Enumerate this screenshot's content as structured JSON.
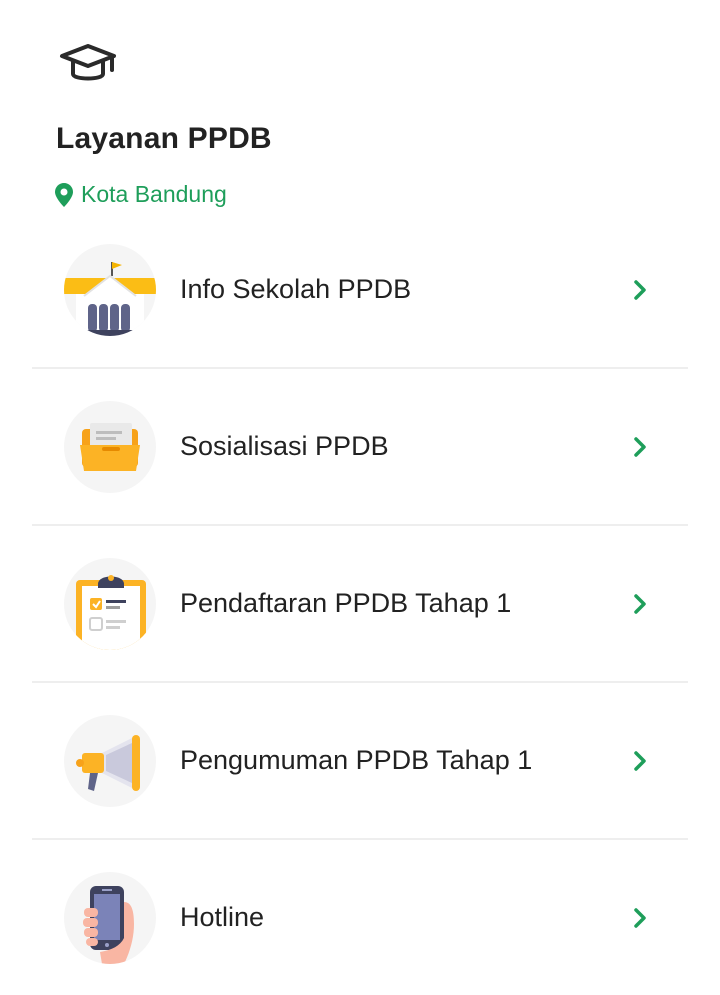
{
  "header": {
    "icon": "graduation-cap-icon",
    "title": "Layanan PPDB",
    "location_icon": "location-pin-icon",
    "location": "Kota Bandung"
  },
  "colors": {
    "accent": "#1e9e5a",
    "title": "#222222",
    "divider": "#eeeeee",
    "icon_bg": "#f5f5f5"
  },
  "menu": {
    "items": [
      {
        "label": "Info Sekolah PPDB",
        "icon": "school-building-icon"
      },
      {
        "label": "Sosialisasi PPDB",
        "icon": "folder-icon"
      },
      {
        "label": "Pendaftaran PPDB Tahap 1",
        "icon": "clipboard-checklist-icon"
      },
      {
        "label": "Pengumuman PPDB Tahap 1",
        "icon": "megaphone-icon"
      },
      {
        "label": "Hotline",
        "icon": "hand-phone-icon"
      }
    ],
    "chevron_icon": "chevron-right-icon"
  }
}
